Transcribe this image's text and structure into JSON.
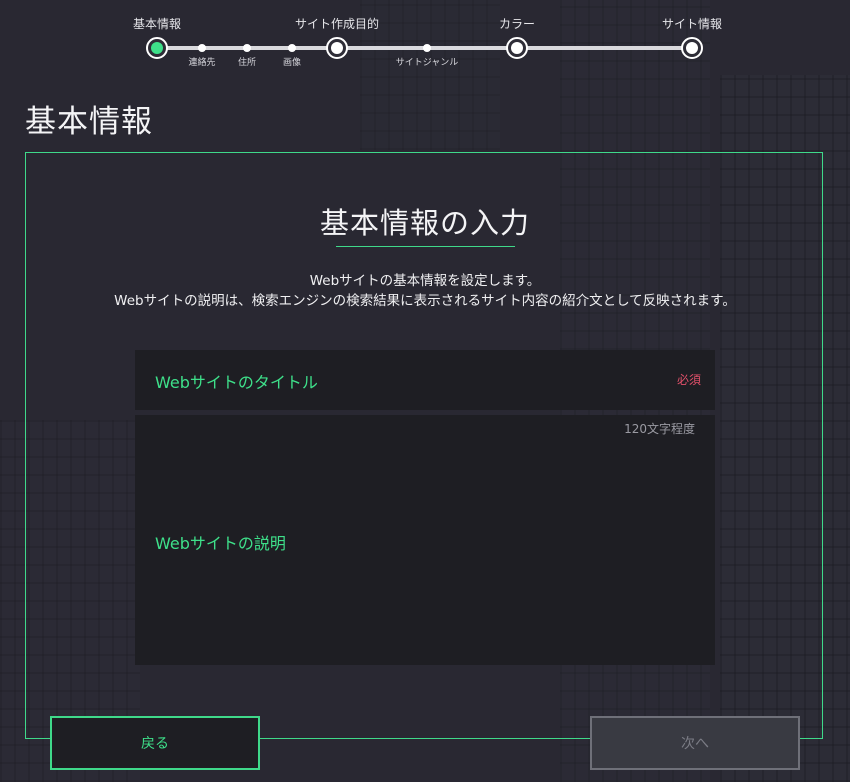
{
  "stepper": {
    "steps": [
      {
        "label": "基本情報",
        "active": true
      },
      {
        "label": "サイト作成目的",
        "active": false
      },
      {
        "label": "カラー",
        "active": false
      },
      {
        "label": "サイト情報",
        "active": false
      }
    ],
    "substeps": [
      "連絡先",
      "住所",
      "画像",
      "サイトジャンル"
    ]
  },
  "page": {
    "title": "基本情報"
  },
  "form": {
    "title": "基本情報の入力",
    "description_line1": "Webサイトの基本情報を設定します。",
    "description_line2": "Webサイトの説明は、検索エンジンの検索結果に表示されるサイト内容の紹介文として反映されます。",
    "fields": {
      "site_title": {
        "label": "Webサイトのタイトル",
        "required_badge": "必須",
        "value": ""
      },
      "site_description": {
        "label": "Webサイトの説明",
        "hint": "120文字程度",
        "value": ""
      }
    }
  },
  "buttons": {
    "back": "戻る",
    "next": "次へ"
  },
  "colors": {
    "accent": "#3ee08a",
    "required": "#e0506a",
    "background": "#2e2d37",
    "field": "#1e1e23"
  }
}
